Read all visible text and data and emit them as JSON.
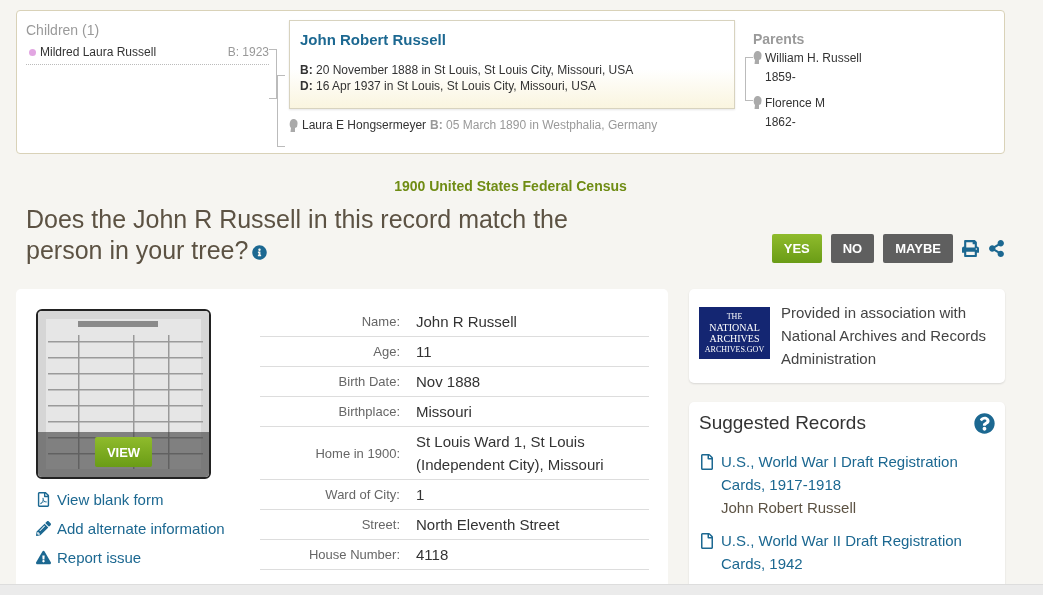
{
  "family": {
    "children_heading": "Children (1)",
    "children": [
      {
        "name": "Mildred Laura Russell",
        "birth": "B: 1923",
        "color": "#e2a6e2"
      }
    ],
    "person": {
      "name": "John Robert Russell",
      "birth_label": "B:",
      "birth": "20 November 1888 in St Louis, St Louis City, Missouri, USA",
      "death_label": "D:",
      "death": "16 Apr 1937 in St Louis, St Louis City, Missouri, USA"
    },
    "spouse": {
      "name": "Laura E Hongsermeyer",
      "birth_label": "B:",
      "birth": "05 March 1890 in Westphalia, Germany"
    },
    "parents_heading": "Parents",
    "parents": [
      {
        "name": "William H. Russell",
        "years": "1859-"
      },
      {
        "name": "Florence M",
        "years": "1862-"
      }
    ]
  },
  "record_title": "1900 United States Federal Census",
  "question": "Does the John R Russell in this record match the person in your tree?",
  "buttons": [
    {
      "label": "YES",
      "kind": "positive"
    },
    {
      "label": "NO",
      "kind": "neutral"
    },
    {
      "label": "MAYBE",
      "kind": "neutral"
    }
  ],
  "record": {
    "view_button": "VIEW",
    "links": [
      {
        "label": "View blank form",
        "kind": "pdf"
      },
      {
        "label": "Add alternate information",
        "kind": "edit"
      },
      {
        "label": "Report issue",
        "kind": "warning"
      }
    ],
    "facts": [
      {
        "label": "Name:",
        "value": "John R Russell"
      },
      {
        "label": "Age:",
        "value": "11"
      },
      {
        "label": "Birth Date:",
        "value": "Nov 1888"
      },
      {
        "label": "Birthplace:",
        "value": "Missouri"
      },
      {
        "label": "Home in 1900:",
        "value": "St Louis Ward 1, St Louis (Independent City), Missouri"
      },
      {
        "label": "Ward of City:",
        "value": "1"
      },
      {
        "label": "Street:",
        "value": "North Eleventh Street"
      },
      {
        "label": "House Number:",
        "value": "4118"
      }
    ]
  },
  "provider": {
    "logo": [
      "THE",
      "NATIONAL",
      "ARCHIVES",
      "ARCHIVES.GOV"
    ],
    "text": "Provided in association with National Archives and Records Administration"
  },
  "suggested": {
    "heading": "Suggested Records",
    "records": [
      {
        "title": "U.S., World War I Draft Registration Cards, 1917-1918",
        "person": "John Robert Russell"
      },
      {
        "title": "U.S., World War II Draft Registration Cards, 1942"
      }
    ]
  }
}
